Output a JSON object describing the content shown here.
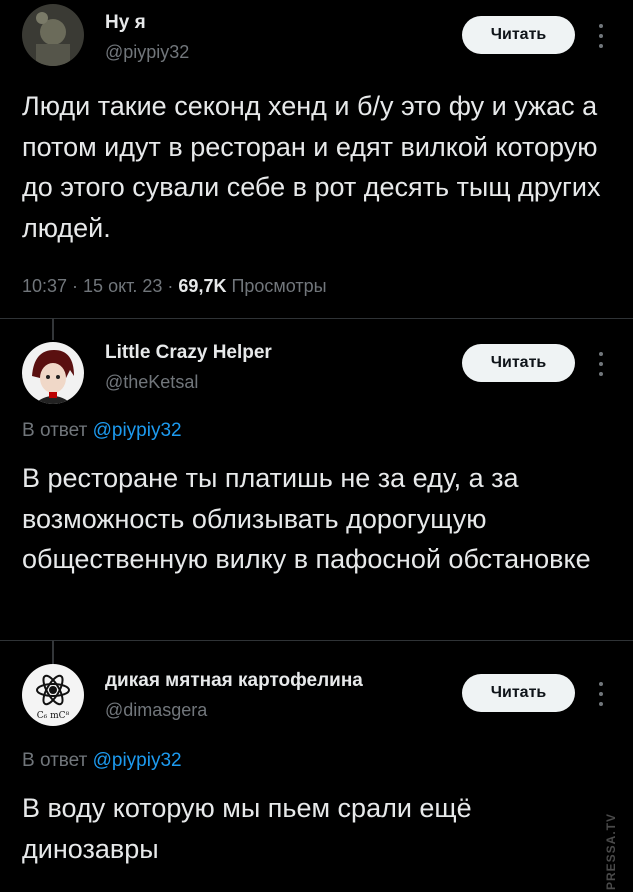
{
  "tweets": [
    {
      "name": "Ну я",
      "handle": "@piypiy32",
      "follow_label": "Читать",
      "text": "Люди такие секонд хенд и б/у это фу и ужас а потом идут в ресторан и едят вилкой которую до этого сували себе в рот десять тыщ других людей.",
      "time": "10:37 · 15 окт. 23 · ",
      "views_count": "69,7K",
      "views_label": " Просмотры"
    },
    {
      "name": "Little Crazy Helper",
      "handle": "@theKetsal",
      "follow_label": "Читать",
      "reply_prefix": "В ответ ",
      "reply_handle": "@piypiy32",
      "text": "В ресторане ты платишь не за еду, а за возможность облизывать дорогущую общественную вилку в пафосной обстановке"
    },
    {
      "name": "дикая мятная картофелина",
      "handle": "@dimasgera",
      "follow_label": "Читать",
      "reply_prefix": "В ответ ",
      "reply_handle": "@piypiy32",
      "text": "В воду которую мы пьем срали ещё динозавры",
      "avatar_text": "C₆ mC⁸"
    }
  ],
  "watermark": "PRESSA.TV",
  "colors": {
    "background": "#000000",
    "text": "#e7e9ea",
    "muted": "#71767b",
    "link": "#1d9bf0",
    "button_bg": "#eff3f4"
  }
}
